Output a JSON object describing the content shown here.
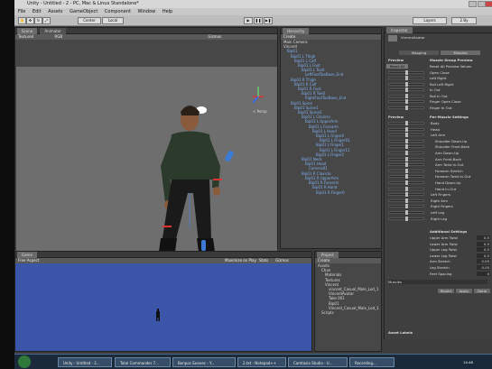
{
  "window": {
    "title": "Unity - Untitled - 2 - PC, Mac & Linux Standalone*"
  },
  "menu": [
    "File",
    "Edit",
    "Assets",
    "GameObject",
    "Component",
    "Window",
    "Help"
  ],
  "toolbar": {
    "pivot": "Center",
    "space": "Local",
    "layers": "Layers",
    "layout": "2 By"
  },
  "scene": {
    "tabs": [
      "Scene",
      "Animator"
    ],
    "mode": "Textured",
    "rgb": "RGB",
    "gizmos": "Gizmos",
    "persp": "< Persp"
  },
  "hierarchy": {
    "tab": "Hierarchy",
    "create": "Create",
    "items": [
      "Main Camera",
      "Vincent",
      "Bip01",
      "Bip01 L Thigh",
      "Bip01 L Calf",
      "Bip01 L Foot",
      "Bip01 L Toe0",
      "LeftFootToeBase_End",
      "Bip01 R Thigh",
      "Bip01 R Calf",
      "Bip01 R Foot",
      "Bip01 R Toe0",
      "RightFootToeBase_End",
      "Bip01 Spine",
      "Bip01 Spine1",
      "Bip01 Spine2",
      "Bip01 L Clavicle",
      "Bip01 L UpperArm",
      "Bip01 L Forearm",
      "Bip01 L Hand",
      "Bip01 L Finger0",
      "Bip01 L Finger01",
      "Bip01 L Finger1",
      "Bip01 L Finger11",
      "Bip01 L Finger2",
      "Bip01 Neck",
      "Bip01 Head",
      "Camera01",
      "Bip01 R Clavicle",
      "Bip01 R UpperArm",
      "Bip01 R Forearm",
      "Bip01 R Hand",
      "Bip01 R Finger0"
    ]
  },
  "game": {
    "tab": "Game",
    "aspect": "Free Aspect",
    "maximize": "Maximize on Play",
    "stats": "Stats",
    "gizmos": "Gizmos"
  },
  "project": {
    "tab": "Project",
    "create": "Create",
    "items": [
      "Assets",
      "Chan",
      "Materials",
      "Textures",
      "Vincent",
      "vincent_Casual_Male_Lod_1",
      "VincentAvatar",
      "Take 001",
      "Bip01",
      "Vincent_Casual_Male_Lod_1",
      "Scripts"
    ]
  },
  "inspector": {
    "tab": "Inspector",
    "name": "VincentAvatar",
    "tabs": [
      "Mapping",
      "Muscles"
    ],
    "preview_label": "Preview",
    "group_label": "Muscle Group Preview",
    "group_items": [
      "Reset All Preview Values",
      "Open Close",
      "Left Right",
      "Roll Left Right",
      "In Out",
      "Roll In Out",
      "Finger Open Close",
      "Finger In Out"
    ],
    "reset_all": "Reset All",
    "per_muscle": "Per-Muscle Settings",
    "muscles": [
      "Body",
      "Head",
      "Left Arm",
      "Shoulder Down-Up",
      "Shoulder Front-Back",
      "Arm Down-Up",
      "Arm Front-Back",
      "Arm Twist In-Out",
      "Forearm Stretch",
      "Forearm Twist In-Out",
      "Hand Down-Up",
      "Hand In-Out",
      "Left Fingers",
      "Right Arm",
      "Right Fingers",
      "Left Leg",
      "Right Leg"
    ],
    "additional": "Additional Settings",
    "settings": [
      {
        "label": "Upper Arm Twist",
        "value": "0.5"
      },
      {
        "label": "Lower Arm Twist",
        "value": "0.5"
      },
      {
        "label": "Upper Leg Twist",
        "value": "0.5"
      },
      {
        "label": "Lower Leg Twist",
        "value": "0.5"
      },
      {
        "label": "Arm Stretch",
        "value": "0.05"
      },
      {
        "label": "Leg Stretch",
        "value": "0.05"
      },
      {
        "label": "Feet Spacing",
        "value": "0"
      }
    ],
    "muscles_footer": "Muscles",
    "revert": "Revert",
    "apply": "Apply",
    "done": "Done",
    "asset_labels": "Asset Labels"
  },
  "taskbar": {
    "tasks": [
      "Unity - Untitled - 2...",
      "Total Commander 7...",
      "Вопрос Бизнес - Y...",
      "2.txt - Notepad++",
      "Camtasia Studio - U...",
      "Recording..."
    ],
    "time": "14:48"
  }
}
